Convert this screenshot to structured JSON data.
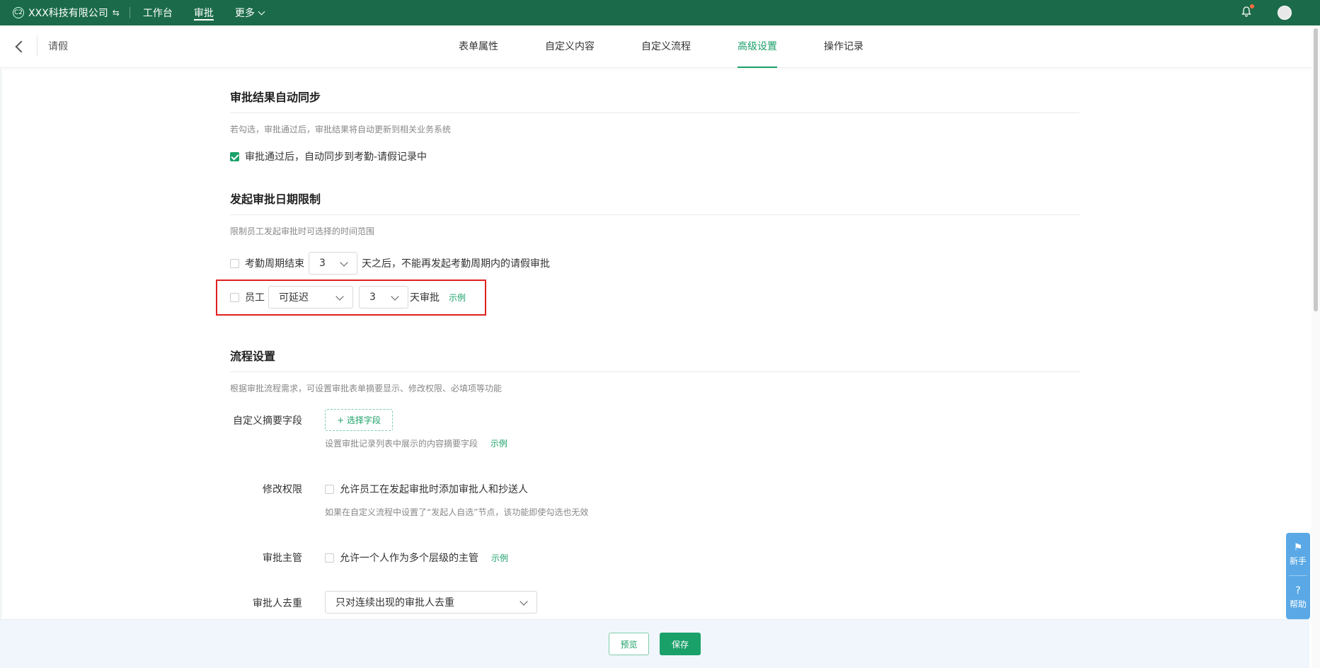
{
  "topbar": {
    "logo_text": "C2",
    "company": "XXX科技有限公司",
    "nav": [
      "工作台",
      "审批",
      "更多"
    ],
    "active_nav": 1
  },
  "header": {
    "page_title": "请假",
    "tabs": [
      "表单属性",
      "自定义内容",
      "自定义流程",
      "高级设置",
      "操作记录"
    ],
    "active_tab": 3
  },
  "sync": {
    "title": "审批结果自动同步",
    "desc": "若勾选，审批通过后，审批结果将自动更新到相关业务系统",
    "checkbox_label": "审批通过后，自动同步到考勤-请假记录中",
    "checked": true
  },
  "date_limit": {
    "title": "发起审批日期限制",
    "desc": "限制员工发起审批时可选择的时间范围",
    "row1": {
      "prefix": "考勤周期结束",
      "select_value": "3",
      "suffix": "天之后，不能再发起考勤周期内的请假审批"
    },
    "row2": {
      "prefix": "员工",
      "mode_value": "可延迟",
      "days_value": "3",
      "suffix": "天审批",
      "example": "示例"
    }
  },
  "flow": {
    "title": "流程设置",
    "desc": "根据审批流程需求，可设置审批表单摘要显示、修改权限、必填项等功能",
    "summary": {
      "label": "自定义摘要字段",
      "button": "+ 选择字段",
      "hint": "设置审批记录列表中展示的内容摘要字段",
      "example": "示例"
    },
    "permission": {
      "label": "修改权限",
      "checkbox_label": "允许员工在发起审批时添加审批人和抄送人",
      "hint": "如果在自定义流程中设置了“发起人自选”节点，该功能即使勾选也无效"
    },
    "manager": {
      "label": "审批主管",
      "checkbox_label": "允许一个人作为多个层级的主管",
      "example": "示例"
    },
    "dedup": {
      "label": "审批人去重",
      "select_value": "只对连续出现的审批人去重"
    }
  },
  "float_help": {
    "items": [
      "新手",
      "帮助"
    ]
  },
  "footer": {
    "preview": "预览",
    "save": "保存"
  },
  "colors": {
    "topbar": "#1b6b4a",
    "accent": "#1aa069",
    "highlight": "#e02020"
  }
}
